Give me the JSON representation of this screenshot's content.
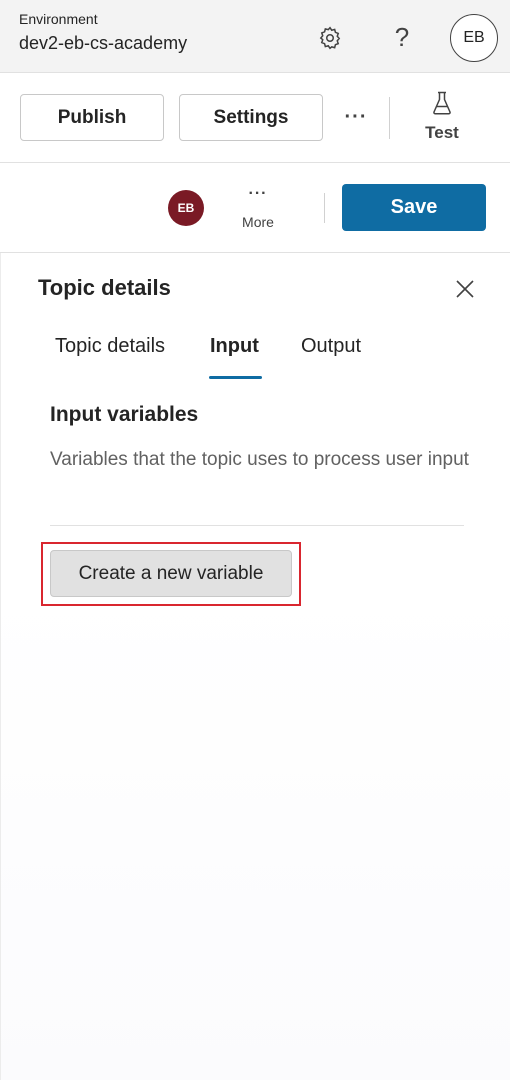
{
  "header": {
    "env_label": "Environment",
    "env_name": "dev2-eb-cs-academy",
    "settings_icon": "gear-icon",
    "help_icon": "question-mark-icon",
    "help_glyph": "?",
    "avatar_initials": "EB"
  },
  "toolbar": {
    "publish_label": "Publish",
    "settings_label": "Settings",
    "more_glyph": "···",
    "test_icon": "flask-icon",
    "test_label": "Test"
  },
  "secondbar": {
    "avatar_initials": "EB",
    "more_glyph": "···",
    "more_label": "More",
    "save_label": "Save"
  },
  "panel": {
    "title": "Topic details",
    "close_icon": "close-icon",
    "tabs": [
      {
        "label": "Topic details",
        "selected": false
      },
      {
        "label": "Input",
        "selected": true
      },
      {
        "label": "Output",
        "selected": false
      }
    ],
    "section_title": "Input variables",
    "section_description": "Variables that the topic uses to process user input",
    "create_button_label": "Create a new variable"
  },
  "colors": {
    "accent": "#0f6ca3",
    "avatar_bg": "#7a1a25",
    "highlight": "#d9262f"
  }
}
